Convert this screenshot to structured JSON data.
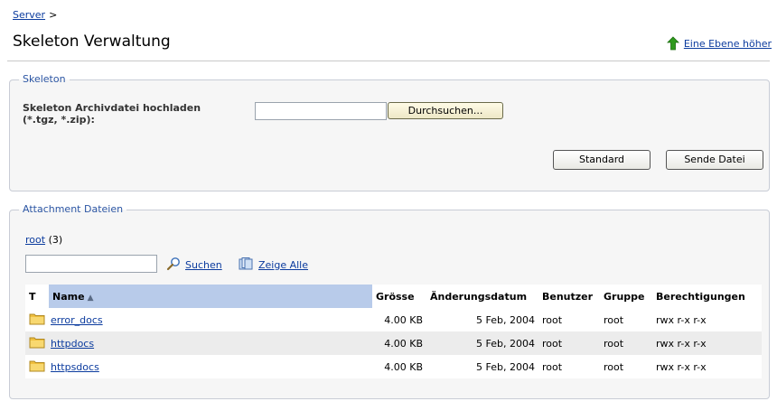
{
  "breadcrumb": {
    "server_link": "Server",
    "separator": ">"
  },
  "page": {
    "title": "Skeleton Verwaltung",
    "up_link": "Eine Ebene höher"
  },
  "skeleton": {
    "legend": "Skeleton",
    "upload_label_line1": "Skeleton Archivdatei hochladen",
    "upload_label_line2": "(*.tgz, *.zip):",
    "file_value": "",
    "browse_button": "Durchsuchen...",
    "standard_button": "Standard",
    "send_button": "Sende Datei"
  },
  "attachments": {
    "legend": "Attachment Dateien",
    "root_link": "root",
    "root_count": "(3)",
    "search_value": "",
    "search_label": "Suchen",
    "show_all_label": "Zeige Alle",
    "columns": {
      "type": "T",
      "name": "Name",
      "sort_indicator": "▲",
      "size": "Grösse",
      "modified": "Änderungsdatum",
      "user": "Benutzer",
      "group": "Gruppe",
      "permissions": "Berechtigungen"
    },
    "rows": [
      {
        "name": "error_docs",
        "size": "4.00 KB",
        "modified": "5 Feb, 2004",
        "user": "root",
        "group": "root",
        "permissions": "rwx r-x r-x"
      },
      {
        "name": "httpdocs",
        "size": "4.00 KB",
        "modified": "5 Feb, 2004",
        "user": "root",
        "group": "root",
        "permissions": "rwx r-x r-x"
      },
      {
        "name": "httpsdocs",
        "size": "4.00 KB",
        "modified": "5 Feb, 2004",
        "user": "root",
        "group": "root",
        "permissions": "rwx r-x r-x"
      }
    ]
  },
  "icons": {
    "up": "green-up-arrow-icon",
    "search": "magnifier-icon",
    "show_all": "show-all-icon",
    "folder": "folder-icon"
  },
  "colors": {
    "link": "#0b3b9e",
    "legend": "#2b55a3",
    "sorted_header": "#b8cbea",
    "alt_row": "#ececec",
    "up_arrow": "#2e9a1c",
    "folder": "#f0c040"
  }
}
